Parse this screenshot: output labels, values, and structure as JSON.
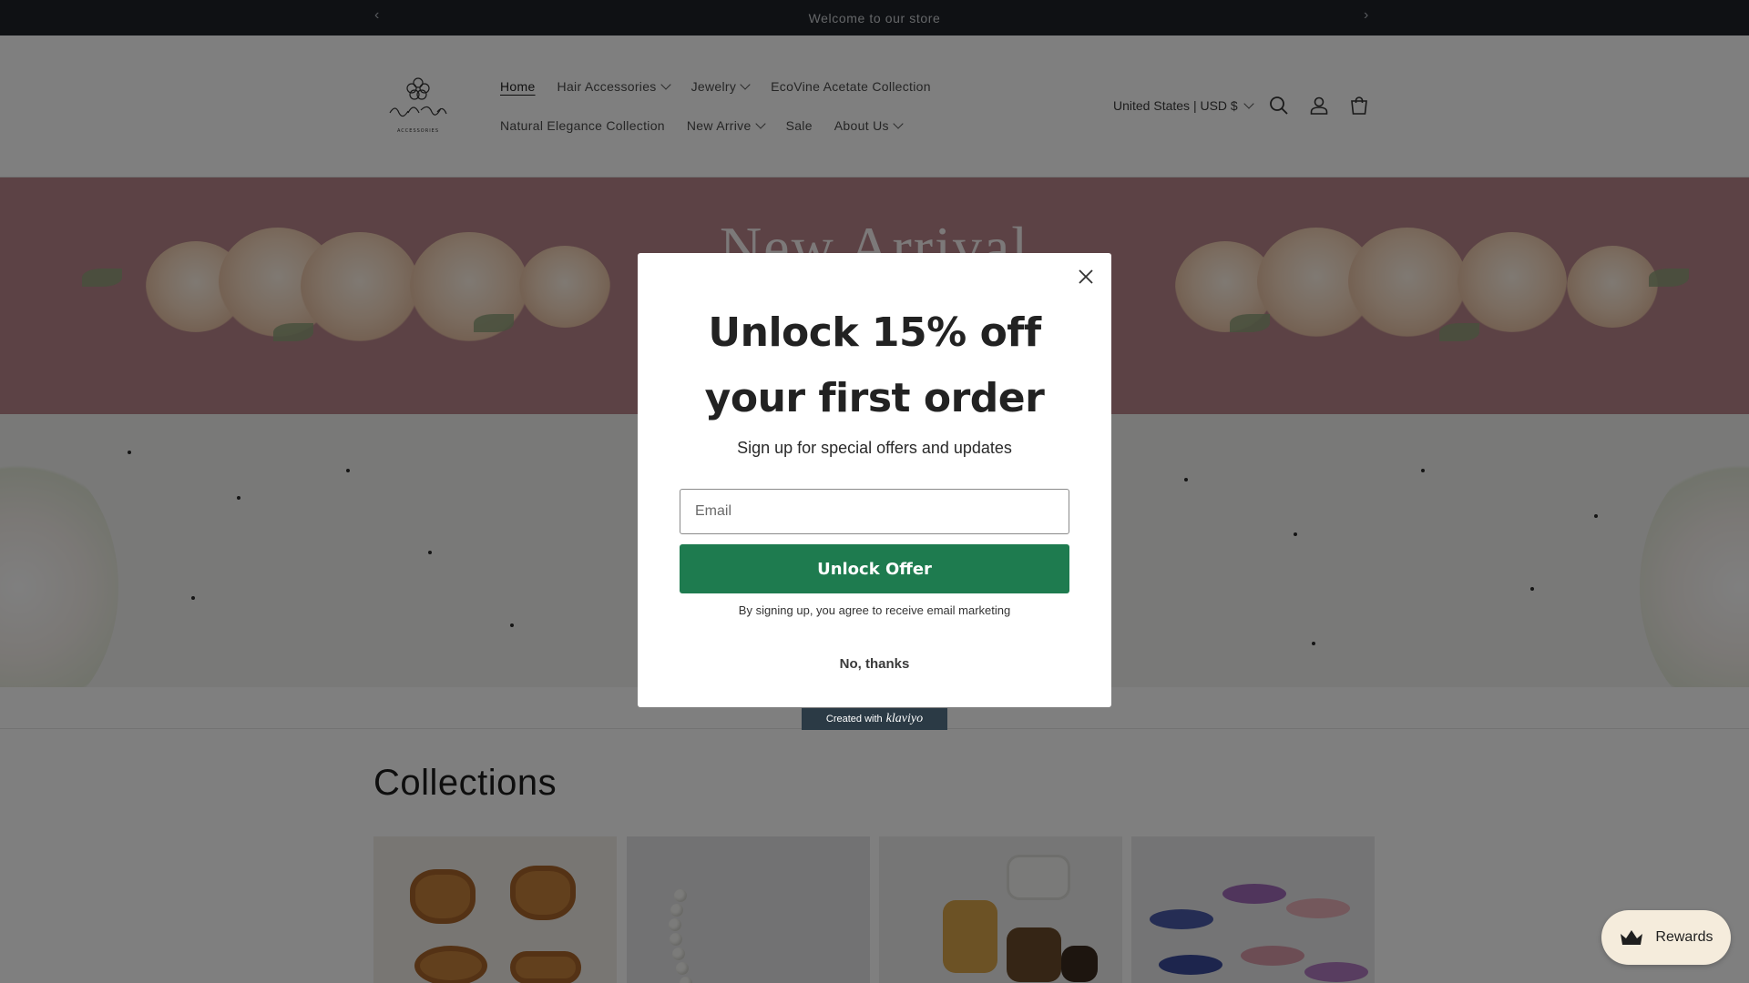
{
  "announcement": {
    "text": "Welcome to our store"
  },
  "header": {
    "nav_row1": [
      {
        "label": "Home",
        "active": true,
        "dropdown": false
      },
      {
        "label": "Hair Accessories",
        "dropdown": true
      },
      {
        "label": "Jewelry",
        "dropdown": true
      },
      {
        "label": "EcoVine Acetate Collection",
        "dropdown": false
      }
    ],
    "nav_row2": [
      {
        "label": "Natural Elegance Collection",
        "dropdown": false
      },
      {
        "label": "New Arrive",
        "dropdown": true
      },
      {
        "label": "Sale",
        "dropdown": false
      },
      {
        "label": "About Us",
        "dropdown": true
      }
    ],
    "currency": "United States | USD $",
    "icons": [
      "search-icon",
      "account-icon",
      "cart-icon"
    ]
  },
  "hero": {
    "title": "New Arrival"
  },
  "collections": {
    "title": "Collections"
  },
  "modal": {
    "title_line1": "Unlock 15% off",
    "title_line2": "your first order",
    "subtitle": "Sign up for special offers and updates",
    "email_placeholder": "Email",
    "button_label": "Unlock Offer",
    "consent": "By signing up, you agree to receive email marketing",
    "dismiss": "No, thanks",
    "button_color": "#1e7b4f"
  },
  "klaviyo_badge": {
    "prefix": "Created with",
    "brand": "klaviyo"
  },
  "rewards": {
    "label": "Rewards"
  }
}
